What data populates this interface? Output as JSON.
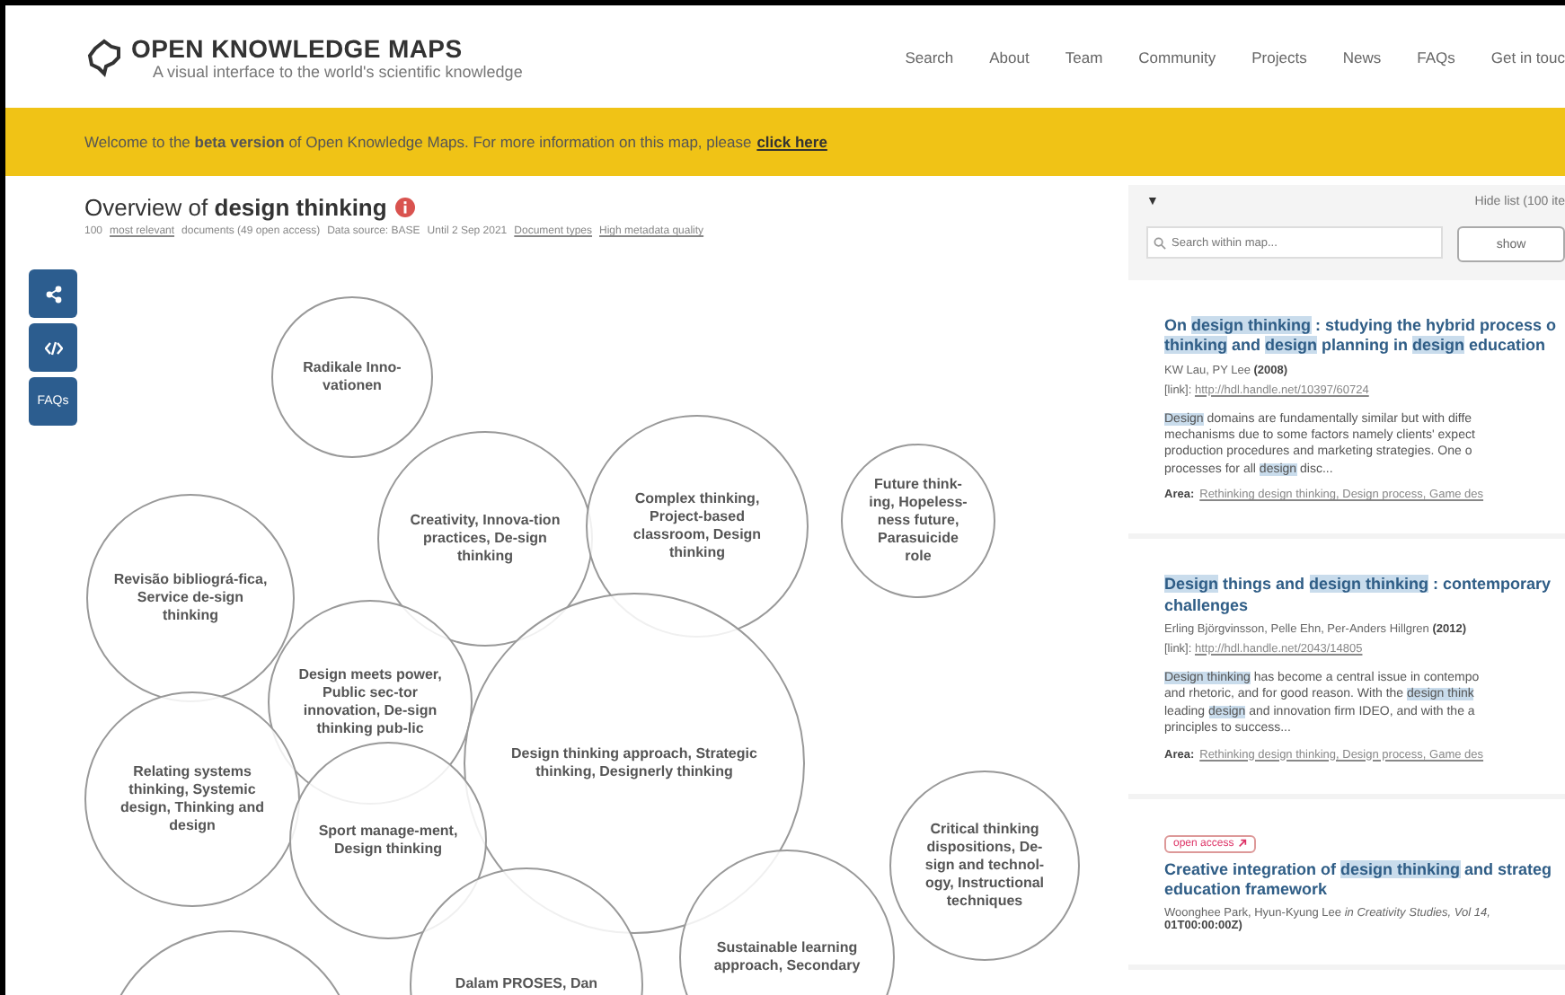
{
  "header": {
    "logo": "OPEN KNOWLEDGE MAPS",
    "tagline": "A visual interface to the world's scientific knowledge",
    "nav": [
      "Search",
      "About",
      "Team",
      "Community",
      "Projects",
      "News",
      "FAQs",
      "Get in touc"
    ]
  },
  "banner": {
    "text": "Welcome to the **beta version** of Open Knowledge Maps. For more information on this map, please",
    "link": "click here"
  },
  "map": {
    "title_prefix": "Overview of",
    "title_query": "design thinking",
    "count": "100",
    "count_link": "most relevant",
    "count_rest": "documents (49 open access)",
    "source": "Data source: BASE",
    "until": "Until 2 Sep 2021",
    "links": [
      "Document types",
      "High metadata quality"
    ],
    "side_buttons": [
      {
        "kind": "share"
      },
      {
        "kind": "embed"
      },
      {
        "kind": "text",
        "label": "FAQs"
      }
    ],
    "bubbles": [
      {
        "label": "Radikale Inno-vationen"
      },
      {
        "label": "Creativity, Innova-tion practices, De-sign thinking"
      },
      {
        "label": "Complex thinking, Project-based classroom, Design thinking"
      },
      {
        "label": "Future think-ing, Hopeless-ness future, Parasuicide role"
      },
      {
        "label": "Revisão bibliográ-fica, Service de-sign thinking"
      },
      {
        "label": "Design meets power, Public sec-tor innovation, De-sign thinking pub-lic"
      },
      {
        "label": "Design thinking approach, Strategic thinking, Designerly thinking"
      },
      {
        "label": "Relating systems thinking, Systemic design, Thinking and design"
      },
      {
        "label": "Sport manage-ment, Design thinking"
      },
      {
        "label": "Critical thinking dispositions, De-sign and technol-ogy, Instructional techniques"
      },
      {
        "label": "Sustainable learning approach, Secondary"
      },
      {
        "label": "Dalam PROSES, Dan"
      }
    ]
  },
  "list": {
    "toggle": "▼",
    "hide": "Hide list (100 ite",
    "search_placeholder": "Search within map...",
    "show_button": "show",
    "papers": [
      {
        "open_access": false,
        "title": [
          [
            {
              "t": "On ",
              "h": false
            },
            {
              "t": "design thinking",
              "h": true
            },
            {
              "t": " : studying the hybrid process o",
              "h": false
            }
          ],
          [
            {
              "t": "thinking",
              "h": true
            },
            {
              "t": " and ",
              "h": false
            },
            {
              "t": "design",
              "h": true
            },
            {
              "t": " planning in ",
              "h": false
            },
            {
              "t": "design",
              "h": true
            },
            {
              "t": " education",
              "h": false
            }
          ]
        ],
        "authors": "KW Lau, PY Lee",
        "year": "(2008)",
        "link_label": "[link]:",
        "link": "http://hdl.handle.net/10397/60724",
        "abstract": [
          [
            {
              "t": "Design",
              "h": true
            },
            {
              "t": " domains are fundamentally similar but with diffe",
              "h": false
            }
          ],
          [
            {
              "t": "mechanisms due to some factors namely clients' expect",
              "h": false
            }
          ],
          [
            {
              "t": "production procedures and marketing strategies. One o",
              "h": false
            }
          ],
          [
            {
              "t": "processes for all ",
              "h": false
            },
            {
              "t": "design",
              "h": true
            },
            {
              "t": " disc...",
              "h": false
            }
          ]
        ],
        "area_label": "Area:",
        "area": "Rethinking design thinking, Design process, Game des"
      },
      {
        "open_access": false,
        "title": [
          [
            {
              "t": "Design",
              "h": true
            },
            {
              "t": " things and ",
              "h": false
            },
            {
              "t": "design thinking",
              "h": true
            },
            {
              "t": " : contemporary",
              "h": false
            }
          ],
          [
            {
              "t": "challenges",
              "h": false
            }
          ]
        ],
        "authors": "Erling Björgvinsson, Pelle Ehn, Per-Anders Hillgren",
        "year": "(2012)",
        "link_label": "[link]:",
        "link": "http://hdl.handle.net/2043/14805",
        "abstract": [
          [
            {
              "t": "Design thinking",
              "h": true
            },
            {
              "t": " has become a central issue in contempo",
              "h": false
            }
          ],
          [
            {
              "t": "and rhetoric, and for good reason. With the ",
              "h": false
            },
            {
              "t": "design think",
              "h": true
            }
          ],
          [
            {
              "t": "leading ",
              "h": false
            },
            {
              "t": "design",
              "h": true
            },
            {
              "t": " and innovation firm IDEO, and with the a",
              "h": false
            }
          ],
          [
            {
              "t": "principles to success...",
              "h": false
            }
          ]
        ],
        "area_label": "Area:",
        "area": "Rethinking design thinking, Design process, Game des"
      },
      {
        "open_access": true,
        "badge": "open access",
        "title": [
          [
            {
              "t": "Creative integration of ",
              "h": false
            },
            {
              "t": "design thinking",
              "h": true
            },
            {
              "t": " and strateg",
              "h": false
            }
          ],
          [
            {
              "t": "education framework",
              "h": false
            }
          ]
        ],
        "authors": "Woonghee Park, Hyun-Kyung Lee",
        "journal": "in Creativity Studies, Vol 14,",
        "date": "01T00:00:00Z)"
      }
    ]
  }
}
